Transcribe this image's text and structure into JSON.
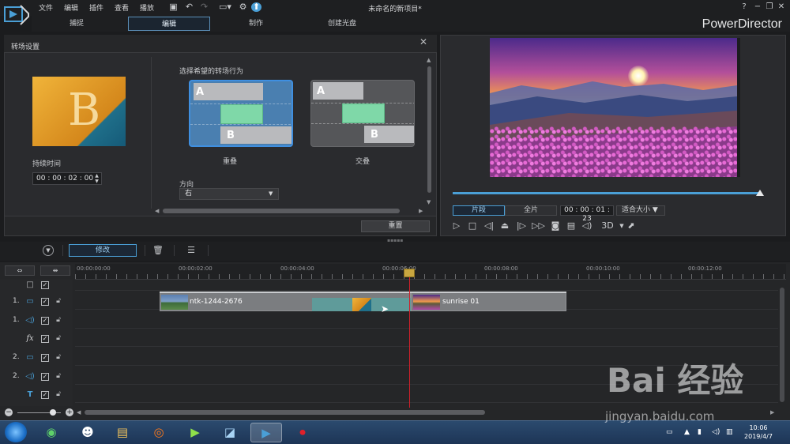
{
  "menu": [
    "文件",
    "编辑",
    "插件",
    "查看",
    "播放"
  ],
  "project_title": "未命名的新项目*",
  "brand": "PowerDirector",
  "mode_tabs": [
    "捕捉",
    "编辑",
    "制作",
    "创建光盘"
  ],
  "window_help": "?",
  "panel": {
    "title": "转场设置",
    "duration_label": "持续时间",
    "duration_value": "00 : 00 : 02 : 00",
    "behavior_label": "选择希望的转场行为",
    "option_overlap": "重叠",
    "option_cross": "交叠",
    "card_a": "A",
    "card_b": "B",
    "direction_label": "方向",
    "direction_value": "右",
    "reset": "重置",
    "thumb_letter": "B"
  },
  "preview": {
    "tab_clip": "片段",
    "tab_movie": "全片",
    "timecode": "00 : 00 : 01 : 23",
    "fit": "适合大小",
    "three_d": "3D"
  },
  "edit_toolbar": {
    "modify": "修改"
  },
  "timeline": {
    "ticks": [
      "00:00:00:00",
      "00:00:02:00",
      "00:00:04:00",
      "00:00:06:00",
      "00:00:08:00",
      "00:00:10:00",
      "00:00:12:00"
    ],
    "tracks": [
      {
        "num": "",
        "icon": "master-video-icon"
      },
      {
        "num": "1.",
        "icon": "video-track-icon"
      },
      {
        "num": "1.",
        "icon": "audio-track-icon"
      },
      {
        "num": "",
        "icon": "fx-track-icon",
        "glyph": "fx"
      },
      {
        "num": "2.",
        "icon": "video-track-icon"
      },
      {
        "num": "2.",
        "icon": "audio-track-icon"
      },
      {
        "num": "",
        "icon": "title-track-icon",
        "glyph": "T"
      }
    ],
    "clip1_name": "ntk-1244-2676",
    "clip2_name": "sunrise 01"
  },
  "taskbar": {
    "time": "10:06",
    "date": "2019/4/7"
  },
  "watermark": {
    "brand": "Bai 经验",
    "url": "jingyan.baidu.com"
  },
  "colors": {
    "accent": "#4a9fd6",
    "playhead": "#d0202a",
    "transition": "#5f9b9a"
  }
}
